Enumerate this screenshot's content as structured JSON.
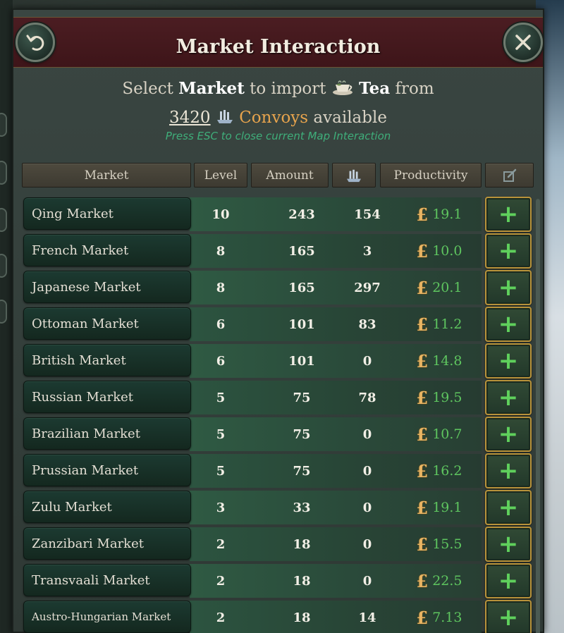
{
  "window": {
    "title": "Market Interaction",
    "back_icon": "undo-arrow-icon",
    "close_icon": "close-x-icon"
  },
  "info": {
    "select": "Select",
    "market_word": "Market",
    "to_import": "to import",
    "good_icon": "tea-cup-icon",
    "good": "Tea",
    "from": "from",
    "convoys_count": "3420",
    "convoy_icon": "convoy-ship-icon",
    "convoys_label": "Convoys",
    "available": "available",
    "esc_hint": "Press ESC to close current Map Interaction"
  },
  "columns": {
    "market": "Market",
    "level": "Level",
    "amount": "Amount",
    "convoy_icon": "convoy-ship-icon",
    "productivity": "Productivity",
    "action_icon": "edit-icon"
  },
  "rows": [
    {
      "market": "Qing Market",
      "level": "10",
      "amount": "243",
      "convoys": "154",
      "productivity": "19.1"
    },
    {
      "market": "French Market",
      "level": "8",
      "amount": "165",
      "convoys": "3",
      "productivity": "10.0"
    },
    {
      "market": "Japanese Market",
      "level": "8",
      "amount": "165",
      "convoys": "297",
      "productivity": "20.1"
    },
    {
      "market": "Ottoman Market",
      "level": "6",
      "amount": "101",
      "convoys": "83",
      "productivity": "11.2"
    },
    {
      "market": "British Market",
      "level": "6",
      "amount": "101",
      "convoys": "0",
      "productivity": "14.8"
    },
    {
      "market": "Russian Market",
      "level": "5",
      "amount": "75",
      "convoys": "78",
      "productivity": "19.5"
    },
    {
      "market": "Brazilian Market",
      "level": "5",
      "amount": "75",
      "convoys": "0",
      "productivity": "10.7"
    },
    {
      "market": "Prussian Market",
      "level": "5",
      "amount": "75",
      "convoys": "0",
      "productivity": "16.2"
    },
    {
      "market": "Zulu Market",
      "level": "3",
      "amount": "33",
      "convoys": "0",
      "productivity": "19.1"
    },
    {
      "market": "Zanzibari Market",
      "level": "2",
      "amount": "18",
      "convoys": "0",
      "productivity": "15.5"
    },
    {
      "market": "Transvaali Market",
      "level": "2",
      "amount": "18",
      "convoys": "0",
      "productivity": "22.5"
    },
    {
      "market": "Austro-Hungarian Market",
      "level": "2",
      "amount": "18",
      "convoys": "14",
      "productivity": "7.13"
    }
  ],
  "symbols": {
    "currency": "£",
    "add": "+"
  },
  "colors": {
    "header_bg": "#4b1d22",
    "productivity_green": "#5ec55f",
    "currency_gold": "#e8b462",
    "convoys_orange": "#e7a44d",
    "hint_green": "#3fae7a",
    "button_border_gold": "#b8923a"
  }
}
